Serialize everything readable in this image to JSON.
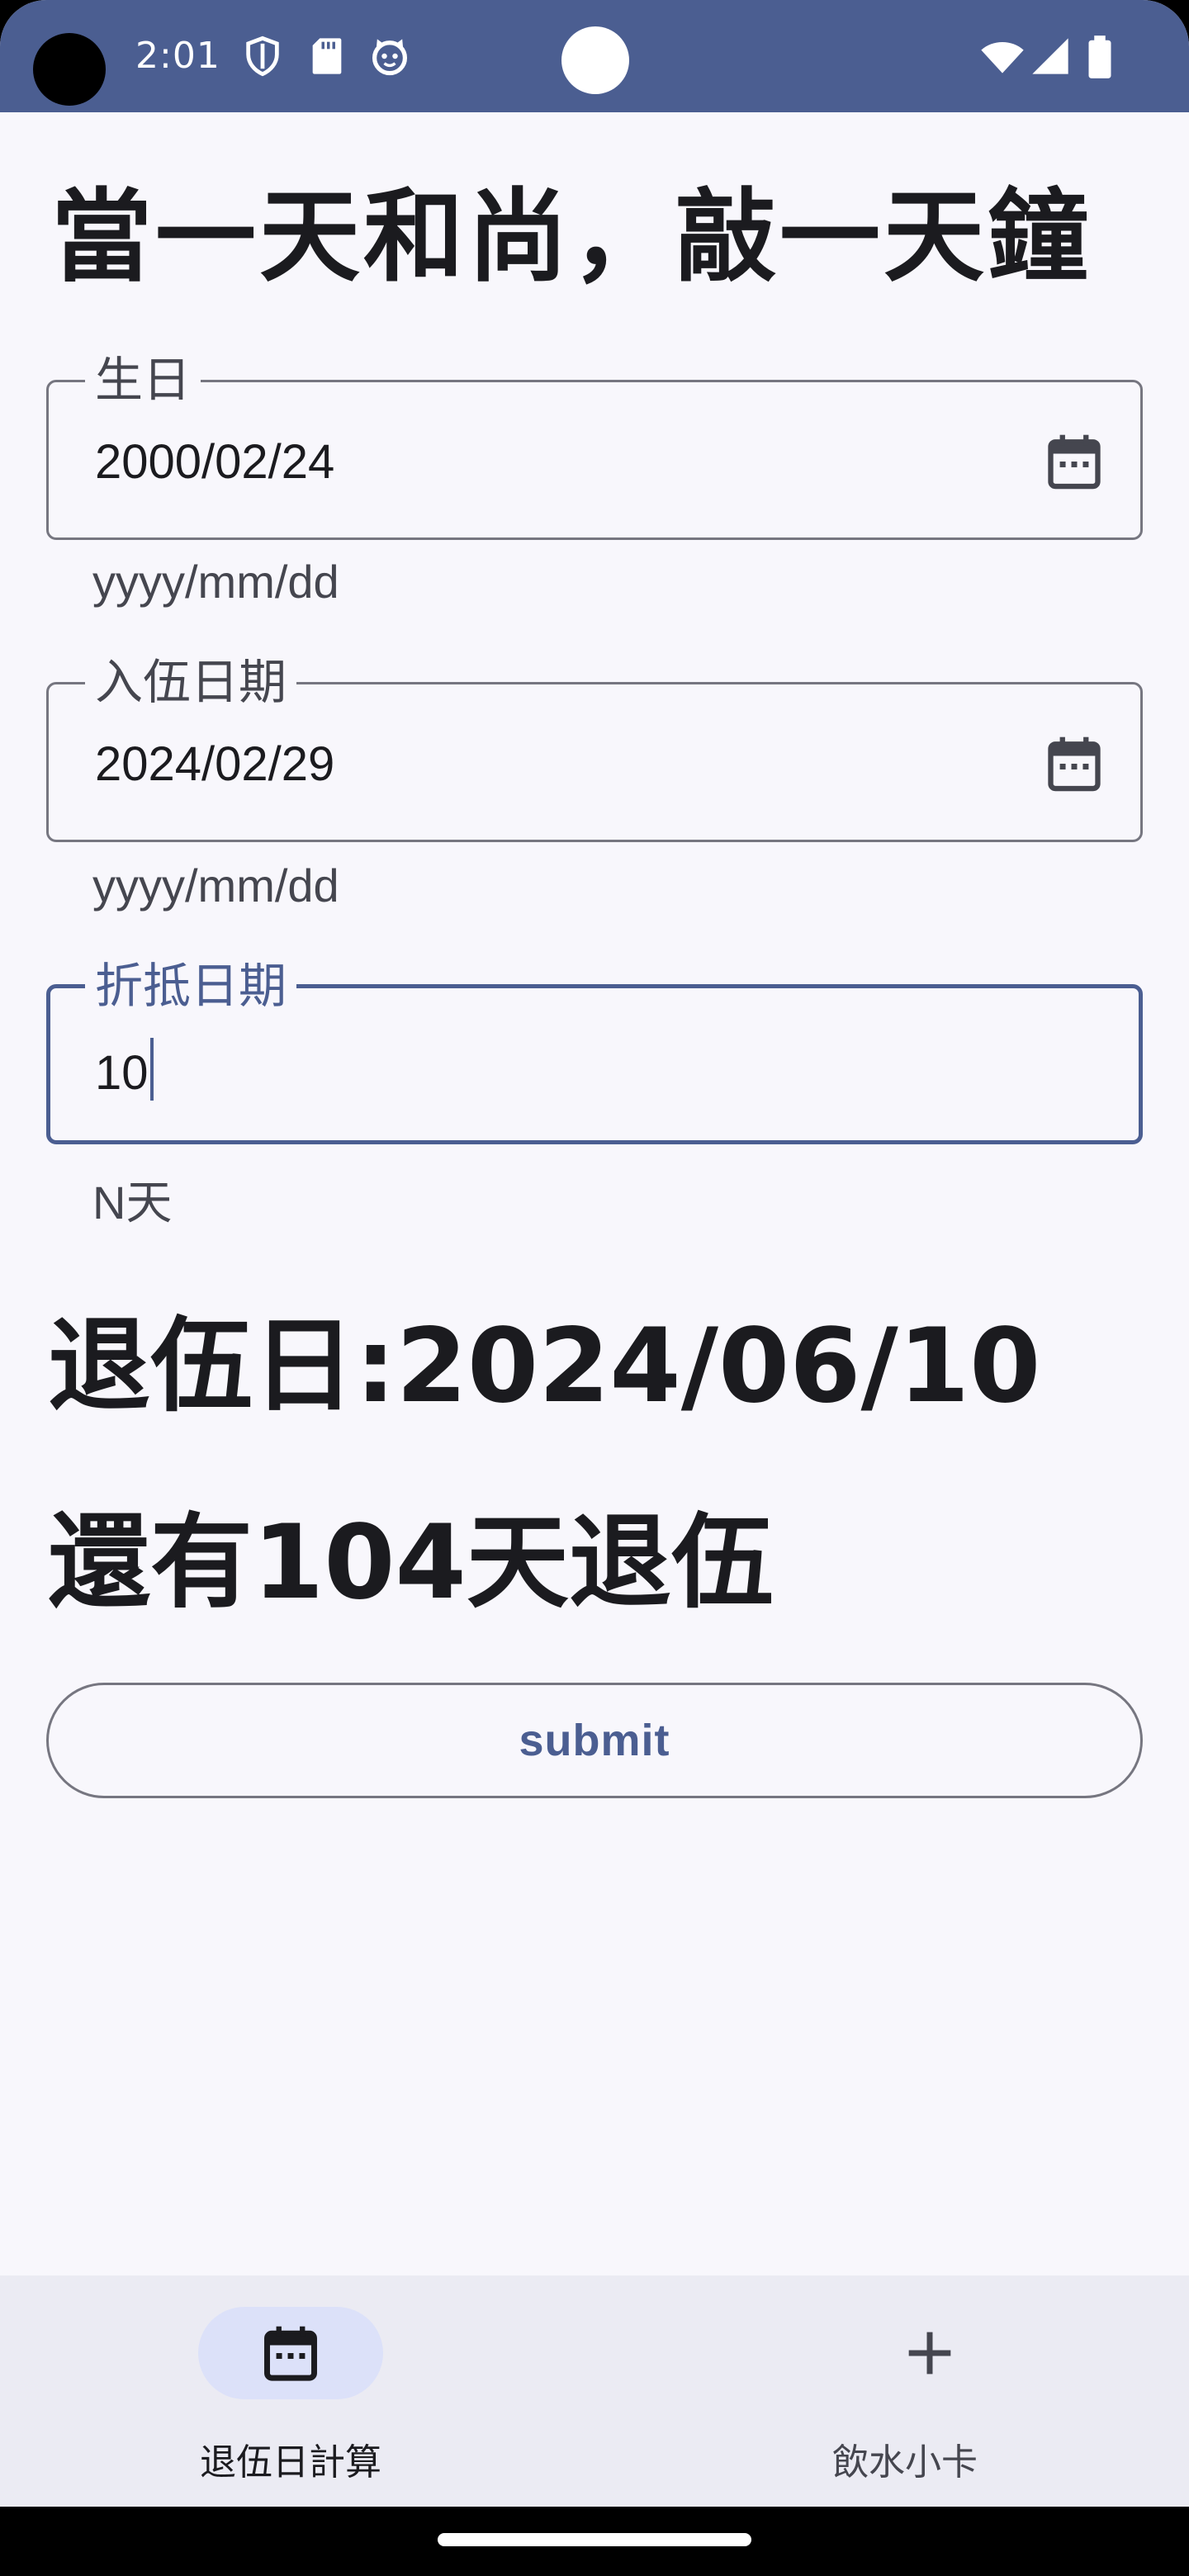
{
  "status_bar": {
    "time": "2:01",
    "icons": [
      "shield-icon",
      "sd-card-icon",
      "cat-face-icon",
      "wifi-icon",
      "cell-signal-icon",
      "battery-icon"
    ]
  },
  "page": {
    "title": "當一天和尚，敲一天鐘"
  },
  "form": {
    "birthday": {
      "label": "生日",
      "value": "2000/02/24",
      "support": "yyyy/mm/dd"
    },
    "enlist_date": {
      "label": "入伍日期",
      "value": "2024/02/29",
      "support": "yyyy/mm/dd"
    },
    "offset_days": {
      "label": "折抵日期",
      "value": "10",
      "support": "N天"
    }
  },
  "result": {
    "discharge_date": "退伍日:2024/06/10",
    "days_left": "還有104天退伍"
  },
  "actions": {
    "submit_label": "submit"
  },
  "bottom_nav": {
    "items": [
      {
        "label": "退伍日計算",
        "icon": "calendar-icon",
        "active": true
      },
      {
        "label": "飲水小卡",
        "icon": "plus-icon",
        "active": false
      }
    ]
  },
  "colors": {
    "primary": "#4b5e91",
    "background": "#f8f7fc",
    "outline": "#767680",
    "nav_background": "#ebebf3",
    "nav_indicator": "#dce1f9",
    "on_surface": "#1b1b1f"
  }
}
